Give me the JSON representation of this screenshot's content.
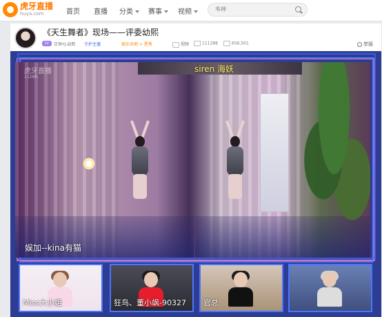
{
  "site": {
    "logo_text": "虎牙直播",
    "logo_sub": "huya.com"
  },
  "nav": {
    "items": [
      "首页",
      "直播",
      "分类",
      "赛事",
      "视频"
    ]
  },
  "search": {
    "placeholder": "韦神"
  },
  "room": {
    "title": "《天生舞者》现场——评委幼熙",
    "level_badge": "LV",
    "host": "正恒YJ-幼熙",
    "guard": "守护主播",
    "category": "娱乐天地 > 星秀",
    "video_label": "视频",
    "viewers": "111288",
    "subscribers": "656,501",
    "report": "举报"
  },
  "player": {
    "top_banner": "siren 海妖",
    "bottom_left": "娱加--kina有猫",
    "watermark": "虎牙直播",
    "watermark_sub": "11288"
  },
  "thumbs": [
    {
      "label": "Miss大小姐"
    },
    {
      "label": "狂鸟、董小飒-90327"
    },
    {
      "label": "官总"
    },
    {
      "label": ""
    }
  ],
  "colors": {
    "accent": "#ff7a00",
    "player_bg": "#2c3d93",
    "pink_border": "#eb6aa8",
    "blue_border": "#4c75ff"
  }
}
